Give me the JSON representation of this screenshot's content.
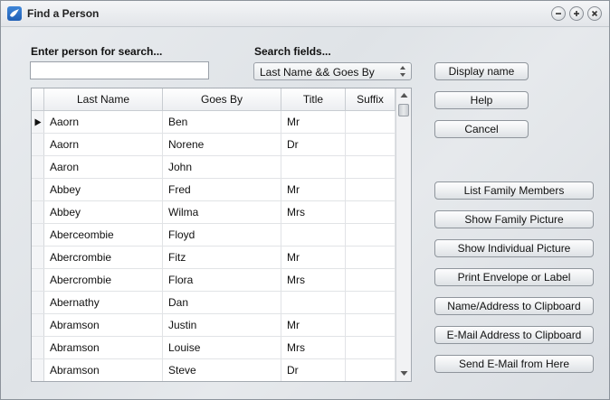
{
  "window": {
    "title": "Find a Person"
  },
  "search": {
    "label": "Enter person for search...",
    "value": ""
  },
  "fields": {
    "label": "Search fields...",
    "selected": "Last Name && Goes By"
  },
  "table": {
    "columns": [
      "Last Name",
      "Goes By",
      "Title",
      "Suffix"
    ],
    "rows": [
      {
        "last": "Aaorn",
        "goes": "Ben",
        "title": "Mr",
        "suffix": ""
      },
      {
        "last": "Aaorn",
        "goes": "Norene",
        "title": "Dr",
        "suffix": ""
      },
      {
        "last": "Aaron",
        "goes": "John",
        "title": "",
        "suffix": ""
      },
      {
        "last": "Abbey",
        "goes": "Fred",
        "title": "Mr",
        "suffix": ""
      },
      {
        "last": "Abbey",
        "goes": "Wilma",
        "title": "Mrs",
        "suffix": ""
      },
      {
        "last": "Aberceombie",
        "goes": "Floyd",
        "title": "",
        "suffix": ""
      },
      {
        "last": "Abercrombie",
        "goes": "Fitz",
        "title": "Mr",
        "suffix": ""
      },
      {
        "last": "Abercrombie",
        "goes": "Flora",
        "title": "Mrs",
        "suffix": ""
      },
      {
        "last": "Abernathy",
        "goes": "Dan",
        "title": "",
        "suffix": ""
      },
      {
        "last": "Abramson",
        "goes": "Justin",
        "title": "Mr",
        "suffix": ""
      },
      {
        "last": "Abramson",
        "goes": "Louise",
        "title": "Mrs",
        "suffix": ""
      },
      {
        "last": "Abramson",
        "goes": "Steve",
        "title": "Dr",
        "suffix": ""
      }
    ]
  },
  "buttons": {
    "display_name": "Display name",
    "help": "Help",
    "cancel": "Cancel",
    "list_family": "List Family Members",
    "family_picture": "Show Family Picture",
    "individual_picture": "Show Individual Picture",
    "print_envelope": "Print Envelope or Label",
    "name_clipboard": "Name/Address to Clipboard",
    "email_clipboard": "E-Mail Address to Clipboard",
    "send_email": "Send E-Mail from Here"
  }
}
